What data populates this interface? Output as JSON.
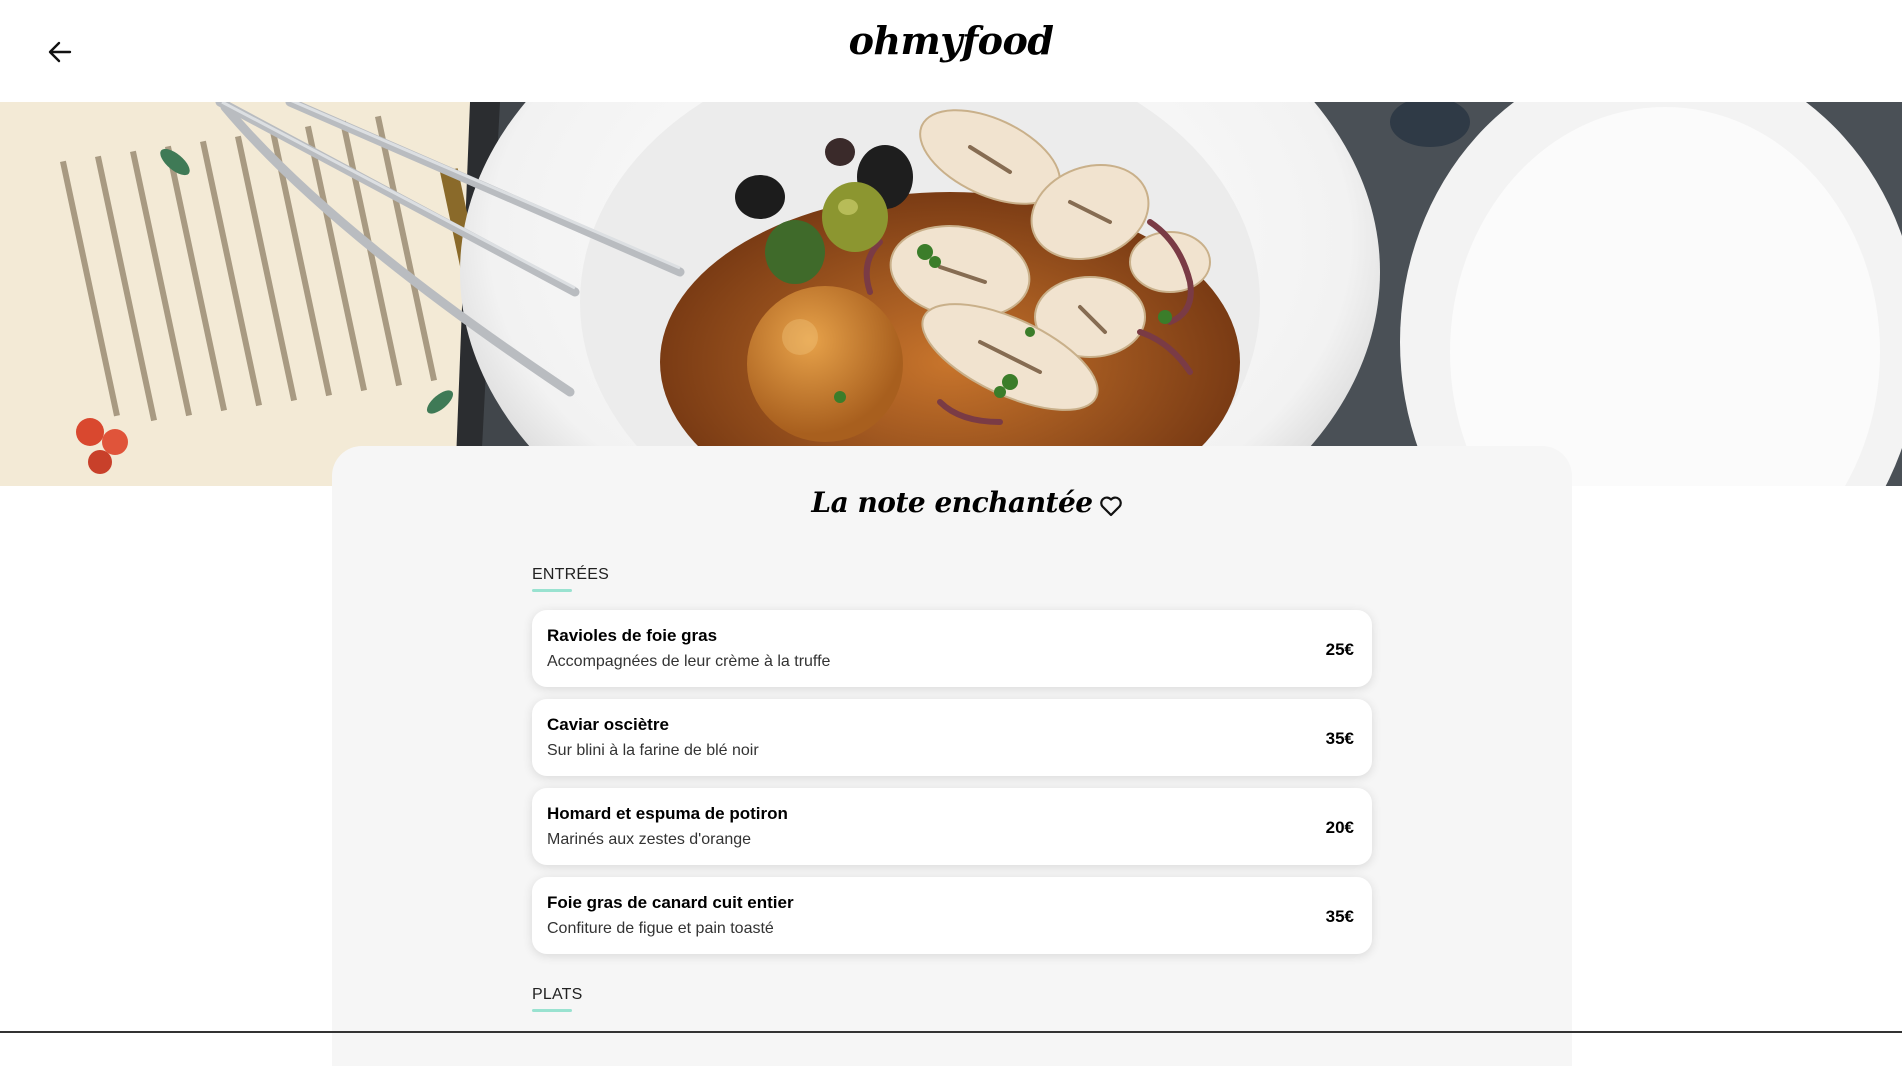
{
  "header": {
    "logo": "ohmyfood",
    "back_icon": "arrow-left-icon"
  },
  "hero": {
    "image_desc": "food-photo"
  },
  "restaurant": {
    "name": "La note enchantée",
    "favorite_icon": "heart-outline-icon"
  },
  "sections": [
    {
      "label": "ENTRÉES",
      "dishes": [
        {
          "name": "Ravioles de foie gras",
          "desc": "Accompagnées de leur crème à la truffe",
          "price": "25€"
        },
        {
          "name": "Caviar osciètre",
          "desc": "Sur blini à la farine de blé noir",
          "price": "35€"
        },
        {
          "name": "Homard et espuma de potiron",
          "desc": "Marinés aux zestes d'orange",
          "price": "20€"
        },
        {
          "name": "Foie gras de canard cuit entier",
          "desc": "Confiture de figue et pain toasté",
          "price": "35€"
        }
      ]
    },
    {
      "label": "PLATS",
      "dishes": []
    }
  ],
  "colors": {
    "accent": "#99e2d0",
    "card_bg": "#f6f6f6"
  }
}
